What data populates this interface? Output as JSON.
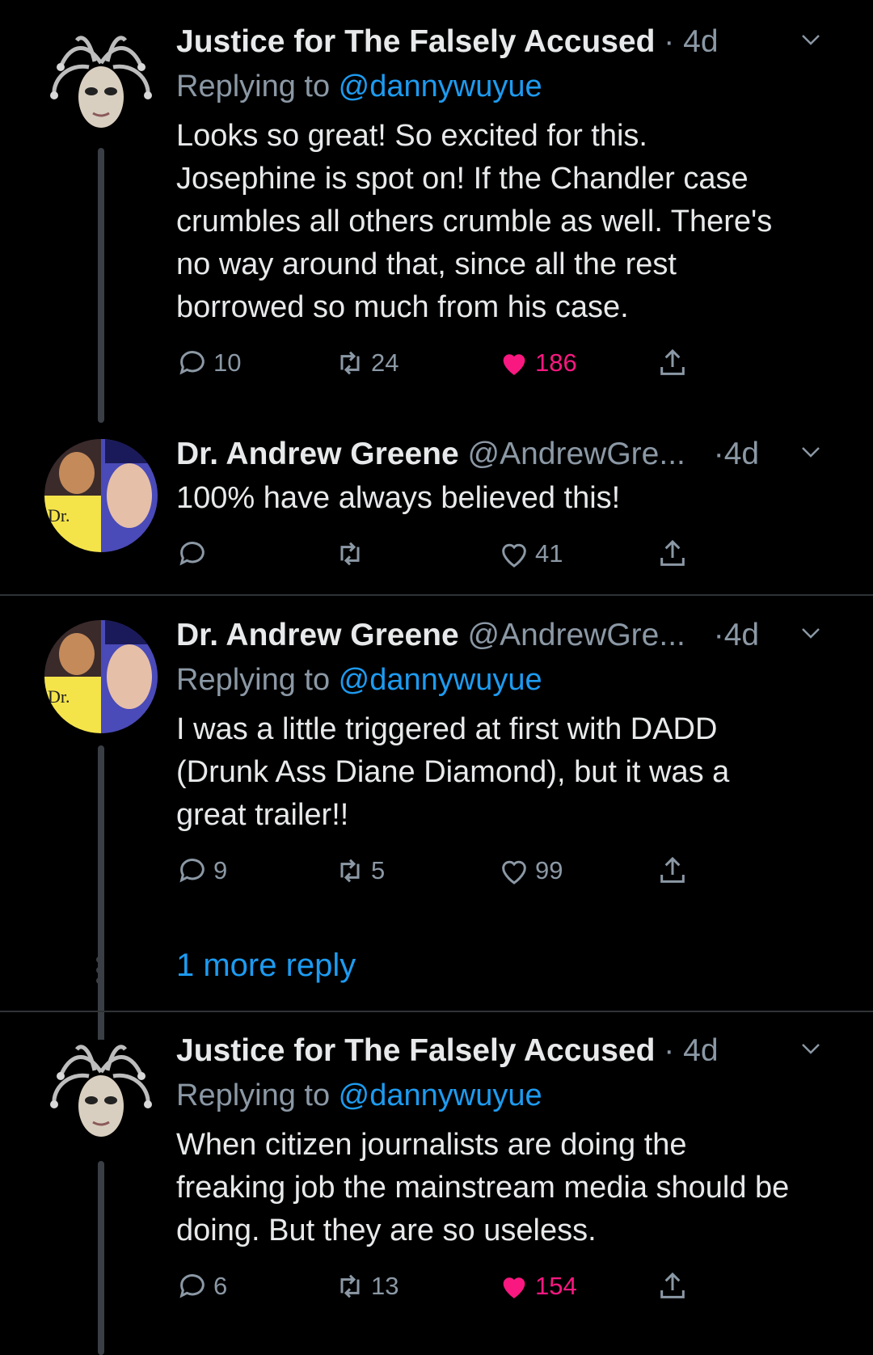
{
  "tweets": [
    {
      "name": "Justice for The Falsely Accused",
      "handle": "",
      "sep": " · ",
      "time": "4d",
      "replying_prefix": "Replying to ",
      "replying_to": "@dannywuyue",
      "text": "Looks so great! So excited for this. Josephine is spot on! If the Chandler case crumbles all others crumble as well. There's no way around that, since all the rest borrowed so much from his case.",
      "replies": "10",
      "retweets": "24",
      "likes": "186",
      "liked": true
    },
    {
      "name": "Dr. Andrew Greene",
      "handle": "@AndrewGre...",
      "sep": " ·",
      "time": "4d",
      "text": "100% have always believed this!",
      "replies": "",
      "retweets": "",
      "likes": "41",
      "liked": false,
      "avatar_label": "Dr."
    },
    {
      "name": "Dr. Andrew Greene",
      "handle": "@AndrewGre...",
      "sep": " ·",
      "time": "4d",
      "replying_prefix": "Replying to ",
      "replying_to": "@dannywuyue",
      "text": "I was a little triggered at first with DADD (Drunk Ass Diane Diamond), but it was a great trailer!!",
      "replies": "9",
      "retweets": "5",
      "likes": "99",
      "liked": false,
      "avatar_label": "Dr."
    },
    {
      "name": "Justice for The Falsely Accused",
      "handle": "",
      "sep": " · ",
      "time": "4d",
      "replying_prefix": "Replying to ",
      "replying_to": "@dannywuyue",
      "text": "When citizen journalists are doing the freaking job the mainstream media should be doing. But they are so useless.",
      "replies": "6",
      "retweets": "13",
      "likes": "154",
      "liked": true
    }
  ],
  "more_reply": "1 more reply",
  "colors": {
    "background": "#000000",
    "accent": "#1d9bf0",
    "like": "#f91880",
    "muted": "#8b98a5"
  }
}
